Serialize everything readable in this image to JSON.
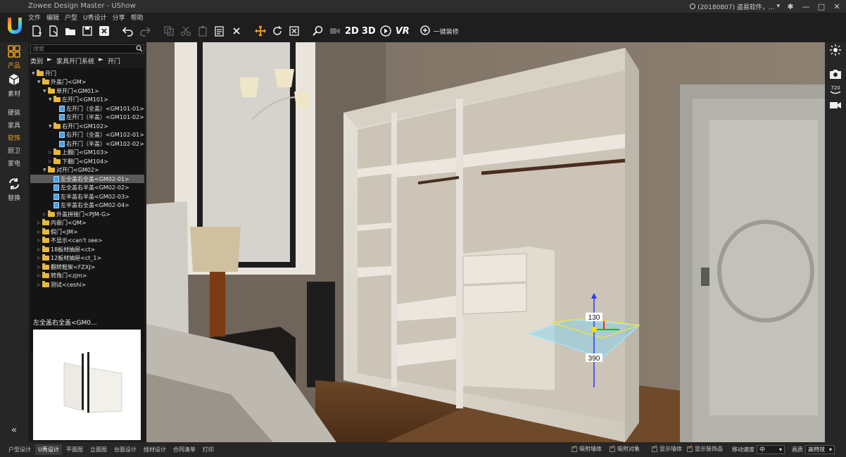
{
  "app": {
    "title": "Zowee Design Master - UShow",
    "user_label": "(20180807) 盗易软件，...",
    "colors": {
      "accent": "#f0a020",
      "selection": "#5a5a5a"
    }
  },
  "menu": [
    "文件",
    "编辑",
    "户型",
    "U秀设计",
    "分享",
    "帮助"
  ],
  "toolbar": {
    "label_2d": "2D",
    "label_3d": "3D",
    "label_vr": "VR",
    "one_click": "一键装修"
  },
  "iconbar": {
    "product": "产品",
    "material": "素材",
    "categories": [
      "硬装",
      "家具",
      "软饰",
      "厨卫",
      "家电"
    ],
    "active_category": "软饰",
    "replace": "替换"
  },
  "panel": {
    "search_placeholder": "搜索",
    "breadcrumb": [
      "类别",
      "►",
      "家具开门系统",
      "►",
      "开门"
    ],
    "tree": [
      {
        "label": "开门",
        "level": 0,
        "kind": "folder",
        "open": true
      },
      {
        "label": "外盖门<GM>",
        "level": 1,
        "kind": "folder",
        "open": true
      },
      {
        "label": "单开门<GM01>",
        "level": 2,
        "kind": "folder",
        "open": true
      },
      {
        "label": "左开门<GM101>",
        "level": 3,
        "kind": "folder",
        "open": true
      },
      {
        "label": "左开门（全盖）<GM101-01>",
        "level": 4,
        "kind": "file"
      },
      {
        "label": "左开门（半盖）<GM101-02>",
        "level": 4,
        "kind": "file"
      },
      {
        "label": "右开门<GM102>",
        "level": 3,
        "kind": "folder",
        "open": true
      },
      {
        "label": "右开门（全盖）<GM102-01>",
        "level": 4,
        "kind": "file"
      },
      {
        "label": "右开门（半盖）<GM102-02>",
        "level": 4,
        "kind": "file"
      },
      {
        "label": "上翻门<GM103>",
        "level": 3,
        "kind": "folder",
        "open": false
      },
      {
        "label": "下翻门<GM104>",
        "level": 3,
        "kind": "folder",
        "open": false
      },
      {
        "label": "对开门<GM02>",
        "level": 2,
        "kind": "folder",
        "open": true
      },
      {
        "label": "左全盖右全盖<GM02-01>",
        "level": 3,
        "kind": "file",
        "selected": true
      },
      {
        "label": "左全盖右半盖<GM02-02>",
        "level": 3,
        "kind": "file"
      },
      {
        "label": "左半盖右半盖<GM02-03>",
        "level": 3,
        "kind": "file"
      },
      {
        "label": "左半盖右全盖<GM02-04>",
        "level": 3,
        "kind": "file"
      },
      {
        "label": "外盖拼接门<PJM-G>",
        "level": 2,
        "kind": "folder",
        "open": false
      },
      {
        "label": "内嵌门<QM>",
        "level": 1,
        "kind": "folder",
        "open": false
      },
      {
        "label": "假门<JM>",
        "level": 1,
        "kind": "folder",
        "open": false
      },
      {
        "label": "不显示<can't see>",
        "level": 1,
        "kind": "folder",
        "open": false
      },
      {
        "label": "18板材抽屉<ct>",
        "level": 1,
        "kind": "folder",
        "open": false
      },
      {
        "label": "12板材抽屉<ct_1>",
        "level": 1,
        "kind": "folder",
        "open": false
      },
      {
        "label": "翻转鞋架<FZXJ>",
        "level": 1,
        "kind": "folder",
        "open": false
      },
      {
        "label": "转角门<zjm>",
        "level": 1,
        "kind": "folder",
        "open": false
      },
      {
        "label": "测试<ceshi>",
        "level": 1,
        "kind": "folder",
        "open": false
      }
    ],
    "selected_name": "左全盖右全盖<GM0..."
  },
  "viewport": {
    "dim_height": "130",
    "dim_floor": "390"
  },
  "bottom": {
    "tabs": [
      "户型设计",
      "U秀设计",
      "平面图",
      "立面图",
      "台面设计",
      "线材设计",
      "合同清单",
      "打印"
    ],
    "active_tab": "U秀设计",
    "options": [
      "吸附墙体",
      "吸附对象",
      "显示墙体",
      "显示装饰品"
    ],
    "speed_label": "移动速度",
    "speed_value": "中",
    "quality_label": "画质",
    "quality_value": "高特效"
  }
}
